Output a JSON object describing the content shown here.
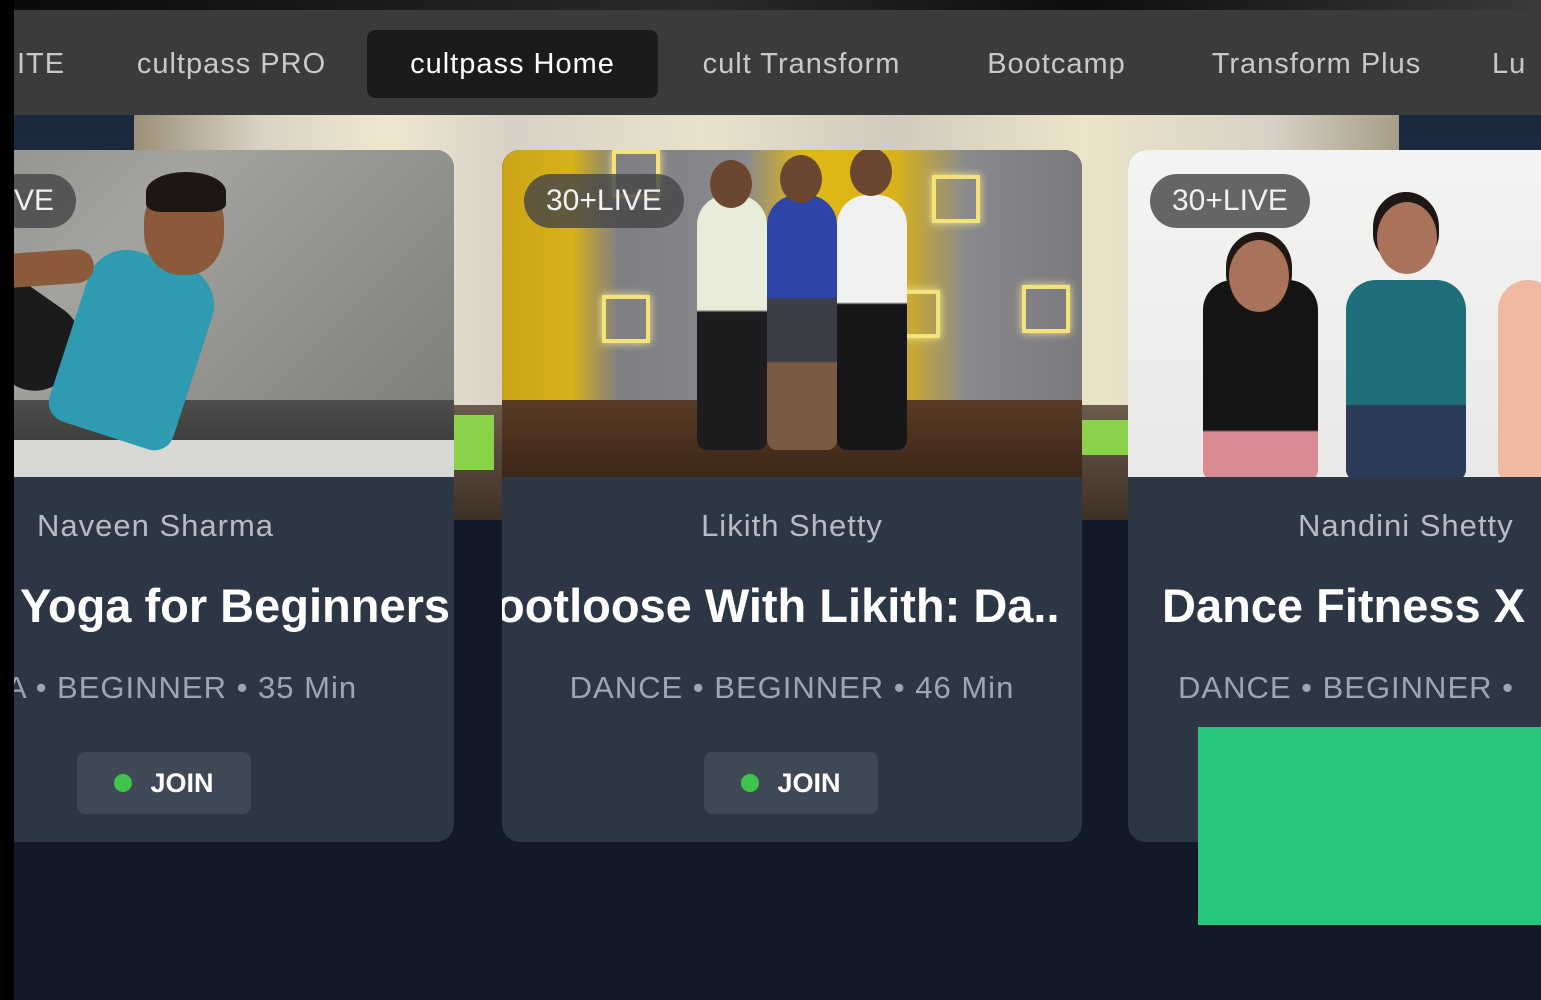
{
  "tabs": [
    {
      "label": "ITE",
      "active": false
    },
    {
      "label": "cultpass PRO",
      "active": false
    },
    {
      "label": "cultpass Home",
      "active": true
    },
    {
      "label": "cult Transform",
      "active": false
    },
    {
      "label": "Bootcamp",
      "active": false
    },
    {
      "label": "Transform Plus",
      "active": false
    },
    {
      "label": "Lu",
      "active": false
    }
  ],
  "cards": [
    {
      "badge": "VE",
      "coach": "Naveen Sharma",
      "title": "Yoga for Beginners",
      "meta": "A • BEGINNER • 35 Min",
      "join_label": "JOIN"
    },
    {
      "badge": "30+LIVE",
      "coach": "Likith Shetty",
      "title": "ootloose With Likith: Da..",
      "meta": "DANCE • BEGINNER • 46 Min",
      "join_label": "JOIN"
    },
    {
      "badge": "30+LIVE",
      "coach": "Nandini Shetty",
      "title": "Dance Fitness X",
      "meta": "DANCE • BEGINNER •",
      "join_label": ""
    }
  ],
  "colors": {
    "tab_bar": "#3b3b3c",
    "tab_active": "#1b1b1d",
    "card_bg": "#2c3644",
    "page_bg": "#111a26",
    "join_dot": "#3fc34b",
    "green_overlay": "#26c67d"
  },
  "icons": {
    "join_status": "live-dot-icon"
  }
}
